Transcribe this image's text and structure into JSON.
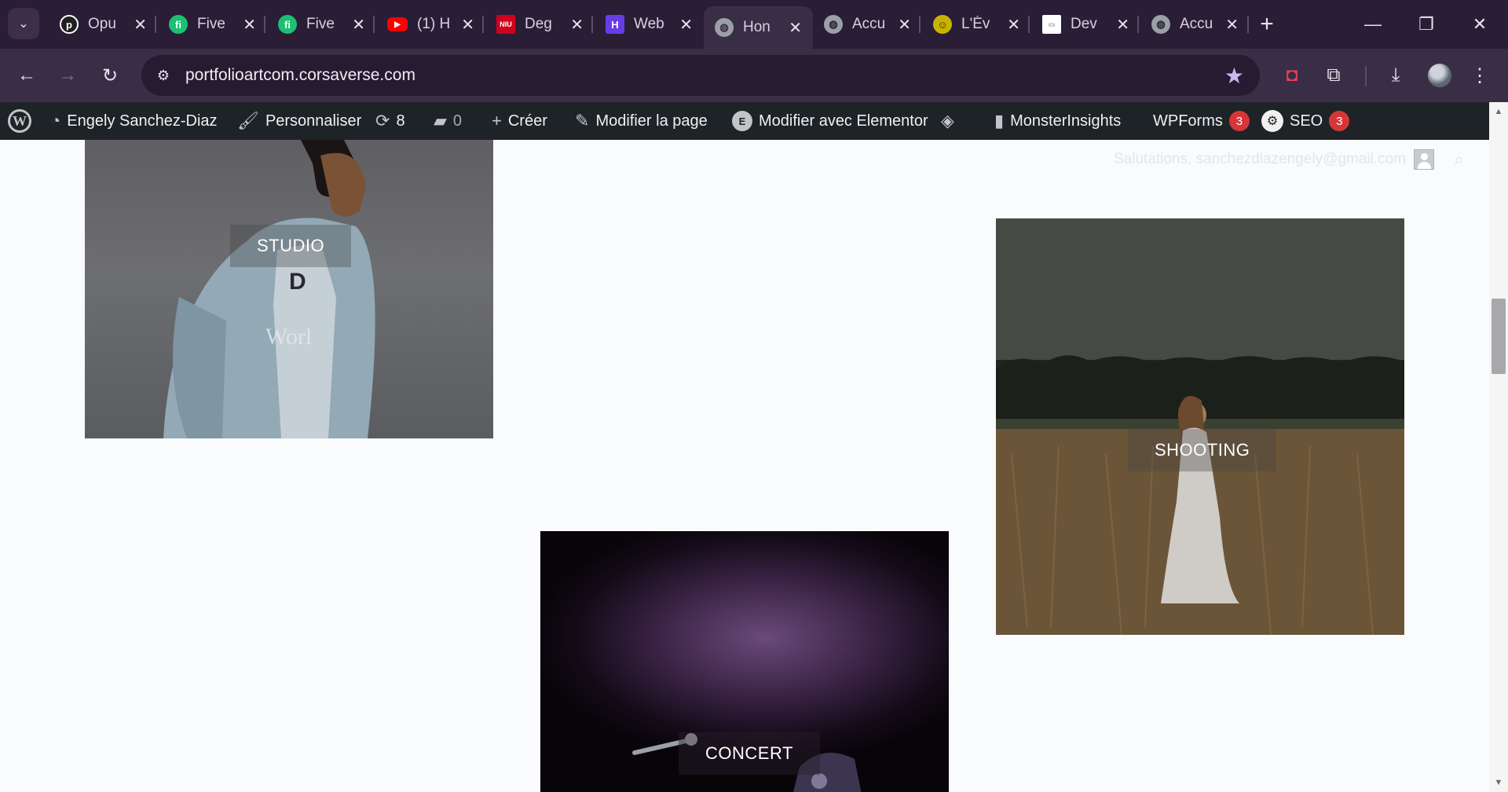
{
  "browser": {
    "tabs": [
      {
        "title": "Opu",
        "favicon": "opus-icon",
        "color": "#ffffff"
      },
      {
        "title": "Five",
        "favicon": "fiverr-icon",
        "color": "#1dbf73"
      },
      {
        "title": "Five",
        "favicon": "fiverr-icon",
        "color": "#1dbf73"
      },
      {
        "title": "(1) H",
        "favicon": "youtube-icon",
        "color": "#ff0000"
      },
      {
        "title": "Deg",
        "favicon": "niu-icon",
        "color": "#d0021b"
      },
      {
        "title": "Web",
        "favicon": "hostinger-icon",
        "color": "#673de6"
      },
      {
        "title": "Hon",
        "favicon": "globe-icon",
        "color": "#9aa0a6"
      },
      {
        "title": "Accu",
        "favicon": "globe-icon",
        "color": "#9aa0a6"
      },
      {
        "title": "L'Év",
        "favicon": "site-logo-icon",
        "color": "#c8b400"
      },
      {
        "title": "Dev",
        "favicon": "document-icon",
        "color": "#ffffff"
      },
      {
        "title": "Accu",
        "favicon": "globe-icon",
        "color": "#9aa0a6"
      }
    ],
    "active_tab_index": 6,
    "url": "portfolioartcom.corsaverse.com",
    "accent": "#2a1d36"
  },
  "wp_admin_bar": {
    "site_name": "Engely Sanchez-Diaz",
    "customize": "Personnaliser",
    "updates_count": "8",
    "comments_count": "0",
    "new": "Créer",
    "edit_page": "Modifier la page",
    "edit_elementor": "Modifier avec Elementor",
    "monsterinsights": "MonsterInsights",
    "wpforms": "WPForms",
    "wpforms_badge": "3",
    "seo": "SEO",
    "seo_badge": "3"
  },
  "page": {
    "greeting": "Salutations, sanchezdiazengely@gmail.com",
    "cards": [
      {
        "label": "STUDIO"
      },
      {
        "label": "SHOOTING"
      },
      {
        "label": "CONCERT"
      }
    ]
  }
}
